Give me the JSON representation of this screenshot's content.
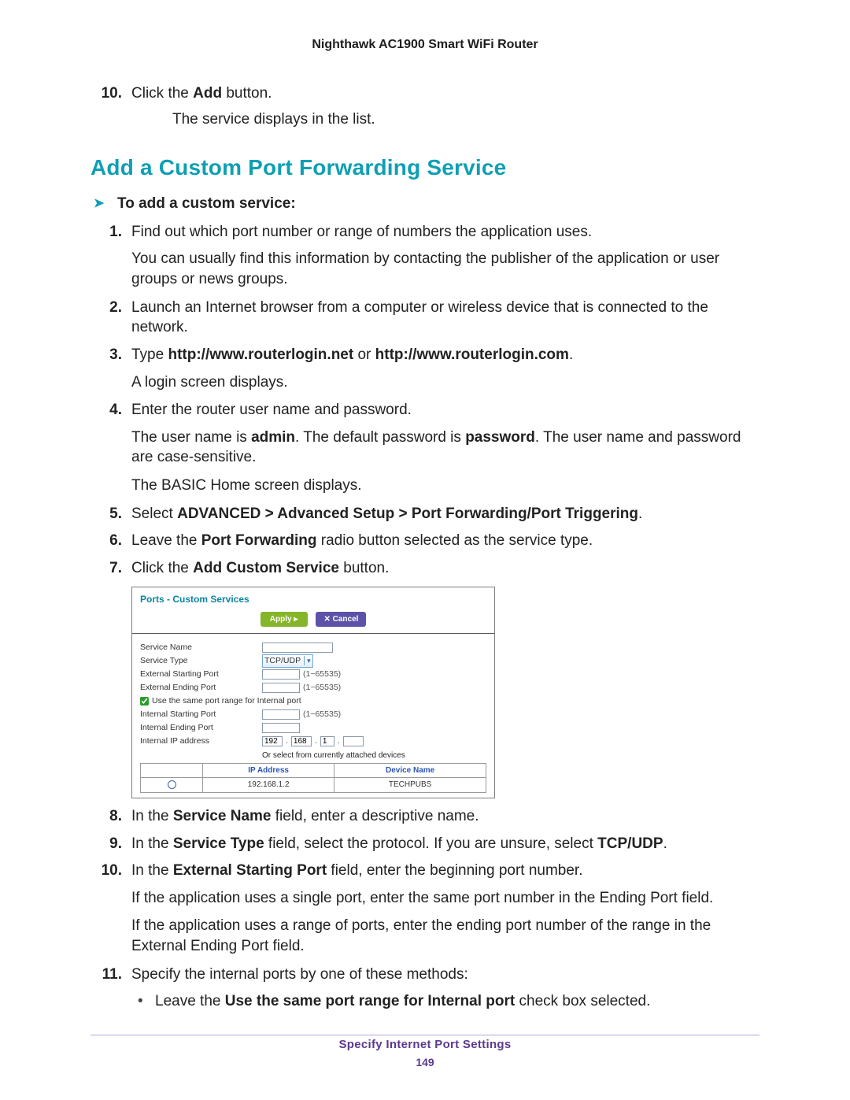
{
  "header": {
    "product": "Nighthawk AC1900 Smart WiFi Router"
  },
  "pre_section": {
    "step": {
      "n": "10.",
      "text_prefix": "Click the ",
      "bold": "Add",
      "text_suffix": " button."
    },
    "after": "The service displays in the list."
  },
  "section": {
    "title": "Add a Custom Port Forwarding Service",
    "lead": "To add a custom service:"
  },
  "steps": [
    {
      "n": "1.",
      "parts": [
        {
          "t": "Find out which port number or range of numbers the application uses."
        }
      ],
      "subs": [
        "You can usually find this information by contacting the publisher of the application or user groups or news groups."
      ]
    },
    {
      "n": "2.",
      "parts": [
        {
          "t": "Launch an Internet browser from a computer or wireless device that is connected to the network."
        }
      ]
    },
    {
      "n": "3.",
      "parts": [
        {
          "t": "Type "
        },
        {
          "b": "http://www.routerlogin.net"
        },
        {
          "t": " or "
        },
        {
          "b": "http://www.routerlogin.com"
        },
        {
          "t": "."
        }
      ],
      "subs": [
        "A login screen displays."
      ]
    },
    {
      "n": "4.",
      "parts": [
        {
          "t": "Enter the router user name and password."
        }
      ],
      "subs_rich": [
        [
          {
            "t": "The user name is "
          },
          {
            "b": "admin"
          },
          {
            "t": ". The default password is "
          },
          {
            "b": "password"
          },
          {
            "t": ". The user name and password are case-sensitive."
          }
        ],
        [
          {
            "t": "The BASIC Home screen displays."
          }
        ]
      ]
    },
    {
      "n": "5.",
      "parts": [
        {
          "t": "Select "
        },
        {
          "b": "ADVANCED > Advanced Setup > Port Forwarding/Port Triggering"
        },
        {
          "t": "."
        }
      ]
    },
    {
      "n": "6.",
      "parts": [
        {
          "t": "Leave the "
        },
        {
          "b": "Port Forwarding"
        },
        {
          "t": " radio button selected as the service type."
        }
      ]
    },
    {
      "n": "7.",
      "parts": [
        {
          "t": "Click the "
        },
        {
          "b": "Add Custom Service"
        },
        {
          "t": " button."
        }
      ]
    }
  ],
  "screenshot": {
    "title": "Ports - Custom Services",
    "apply": "Apply ▸",
    "cancel": "✕ Cancel",
    "labels": {
      "serviceName": "Service Name",
      "serviceType": "Service Type",
      "extStart": "External Starting Port",
      "extEnd": "External Ending Port",
      "samePort": "Use the same port range for Internal port",
      "intStart": "Internal Starting Port",
      "intEnd": "Internal Ending Port",
      "intIP": "Internal IP address",
      "orSelect": "Or select from currently attached devices"
    },
    "values": {
      "serviceType": "TCP/UDP",
      "rangeHint": "(1~65535)",
      "ip": [
        "192",
        "168",
        "1",
        ""
      ]
    },
    "table": {
      "cols": [
        "",
        "IP Address",
        "Device Name"
      ],
      "row": [
        "",
        "192.168.1.2",
        "TECHPUBS"
      ]
    }
  },
  "steps2": [
    {
      "n": "8.",
      "parts": [
        {
          "t": "In the "
        },
        {
          "b": "Service Name"
        },
        {
          "t": " field, enter a descriptive name."
        }
      ]
    },
    {
      "n": "9.",
      "parts": [
        {
          "t": "In the "
        },
        {
          "b": "Service Type"
        },
        {
          "t": " field, select the protocol. If you are unsure, select "
        },
        {
          "b": "TCP/UDP"
        },
        {
          "t": "."
        }
      ]
    },
    {
      "n": "10.",
      "parts": [
        {
          "t": "In the "
        },
        {
          "b": "External Starting Port"
        },
        {
          "t": " field, enter the beginning port number."
        }
      ],
      "subs": [
        "If the application uses a single port, enter the same port number in the Ending Port field.",
        "If the application uses a range of ports, enter the ending port number of the range in the External Ending Port field."
      ]
    },
    {
      "n": "11.",
      "parts": [
        {
          "t": "Specify the internal ports by one of these methods:"
        }
      ],
      "bullets": [
        [
          {
            "t": "Leave the "
          },
          {
            "b": "Use the same port range for Internal port"
          },
          {
            "t": " check box selected."
          }
        ]
      ]
    }
  ],
  "footer": {
    "section": "Specify Internet Port Settings",
    "page": "149"
  }
}
